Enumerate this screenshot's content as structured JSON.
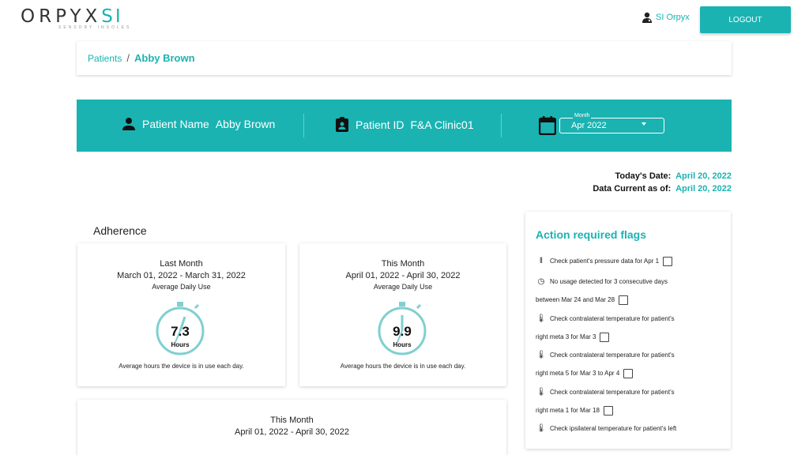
{
  "brand": {
    "name": "ORPYX",
    "suffix": "SI",
    "tagline": "SENSORY INSOLES"
  },
  "header": {
    "user_name": "SI Orpyx",
    "logout_label": "LOGOUT"
  },
  "breadcrumb": {
    "parent": "Patients",
    "separator": "/",
    "current": "Abby Brown"
  },
  "patient": {
    "name_label": "Patient Name",
    "name_value": "Abby Brown",
    "id_label": "Patient ID",
    "id_value": "F&A Clinic01",
    "month_label": "Month",
    "month_value": "Apr 2022"
  },
  "dates": {
    "today_label": "Today's Date:",
    "today_value": "April 20, 2022",
    "current_label": "Data Current as of:",
    "current_value": "April 20, 2022"
  },
  "adherence": {
    "title": "Adherence",
    "cards": [
      {
        "period": "Last Month",
        "range": "March 01, 2022 - March 31, 2022",
        "metric": "Average Daily Use",
        "value": "7.3",
        "unit": "Hours",
        "footnote": "Average hours the device is in use each day."
      },
      {
        "period": "This Month",
        "range": "April 01, 2022 - April 30, 2022",
        "metric": "Average Daily Use",
        "value": "9.9",
        "unit": "Hours",
        "footnote": "Average hours the device is in use each day."
      }
    ],
    "bottom_card": {
      "period": "This Month",
      "range": "April 01, 2022 - April 30, 2022"
    }
  },
  "flags": {
    "title": "Action required flags",
    "items": [
      {
        "icon": "pressure-icon",
        "line1": "Check patient's pressure data for Apr 1",
        "line2": ""
      },
      {
        "icon": "clock-icon",
        "line1": "No usage detected for 3 consecutive days",
        "line2": "between Mar 24 and Mar 28"
      },
      {
        "icon": "thermometer-icon",
        "line1": "Check contralateral temperature for patient's",
        "line2": "right meta 3 for Mar 3"
      },
      {
        "icon": "thermometer-icon",
        "line1": "Check contralateral temperature for patient's",
        "line2": "right meta 5 for Mar 3 to Apr 4"
      },
      {
        "icon": "thermometer-icon",
        "line1": "Check contralateral temperature for patient's",
        "line2": "right meta 1 for Mar 18"
      },
      {
        "icon": "thermometer-icon",
        "line1": "Check ipsilateral temperature for patient's left",
        "line2": ""
      }
    ]
  },
  "colors": {
    "accent": "#1ab3b2"
  }
}
